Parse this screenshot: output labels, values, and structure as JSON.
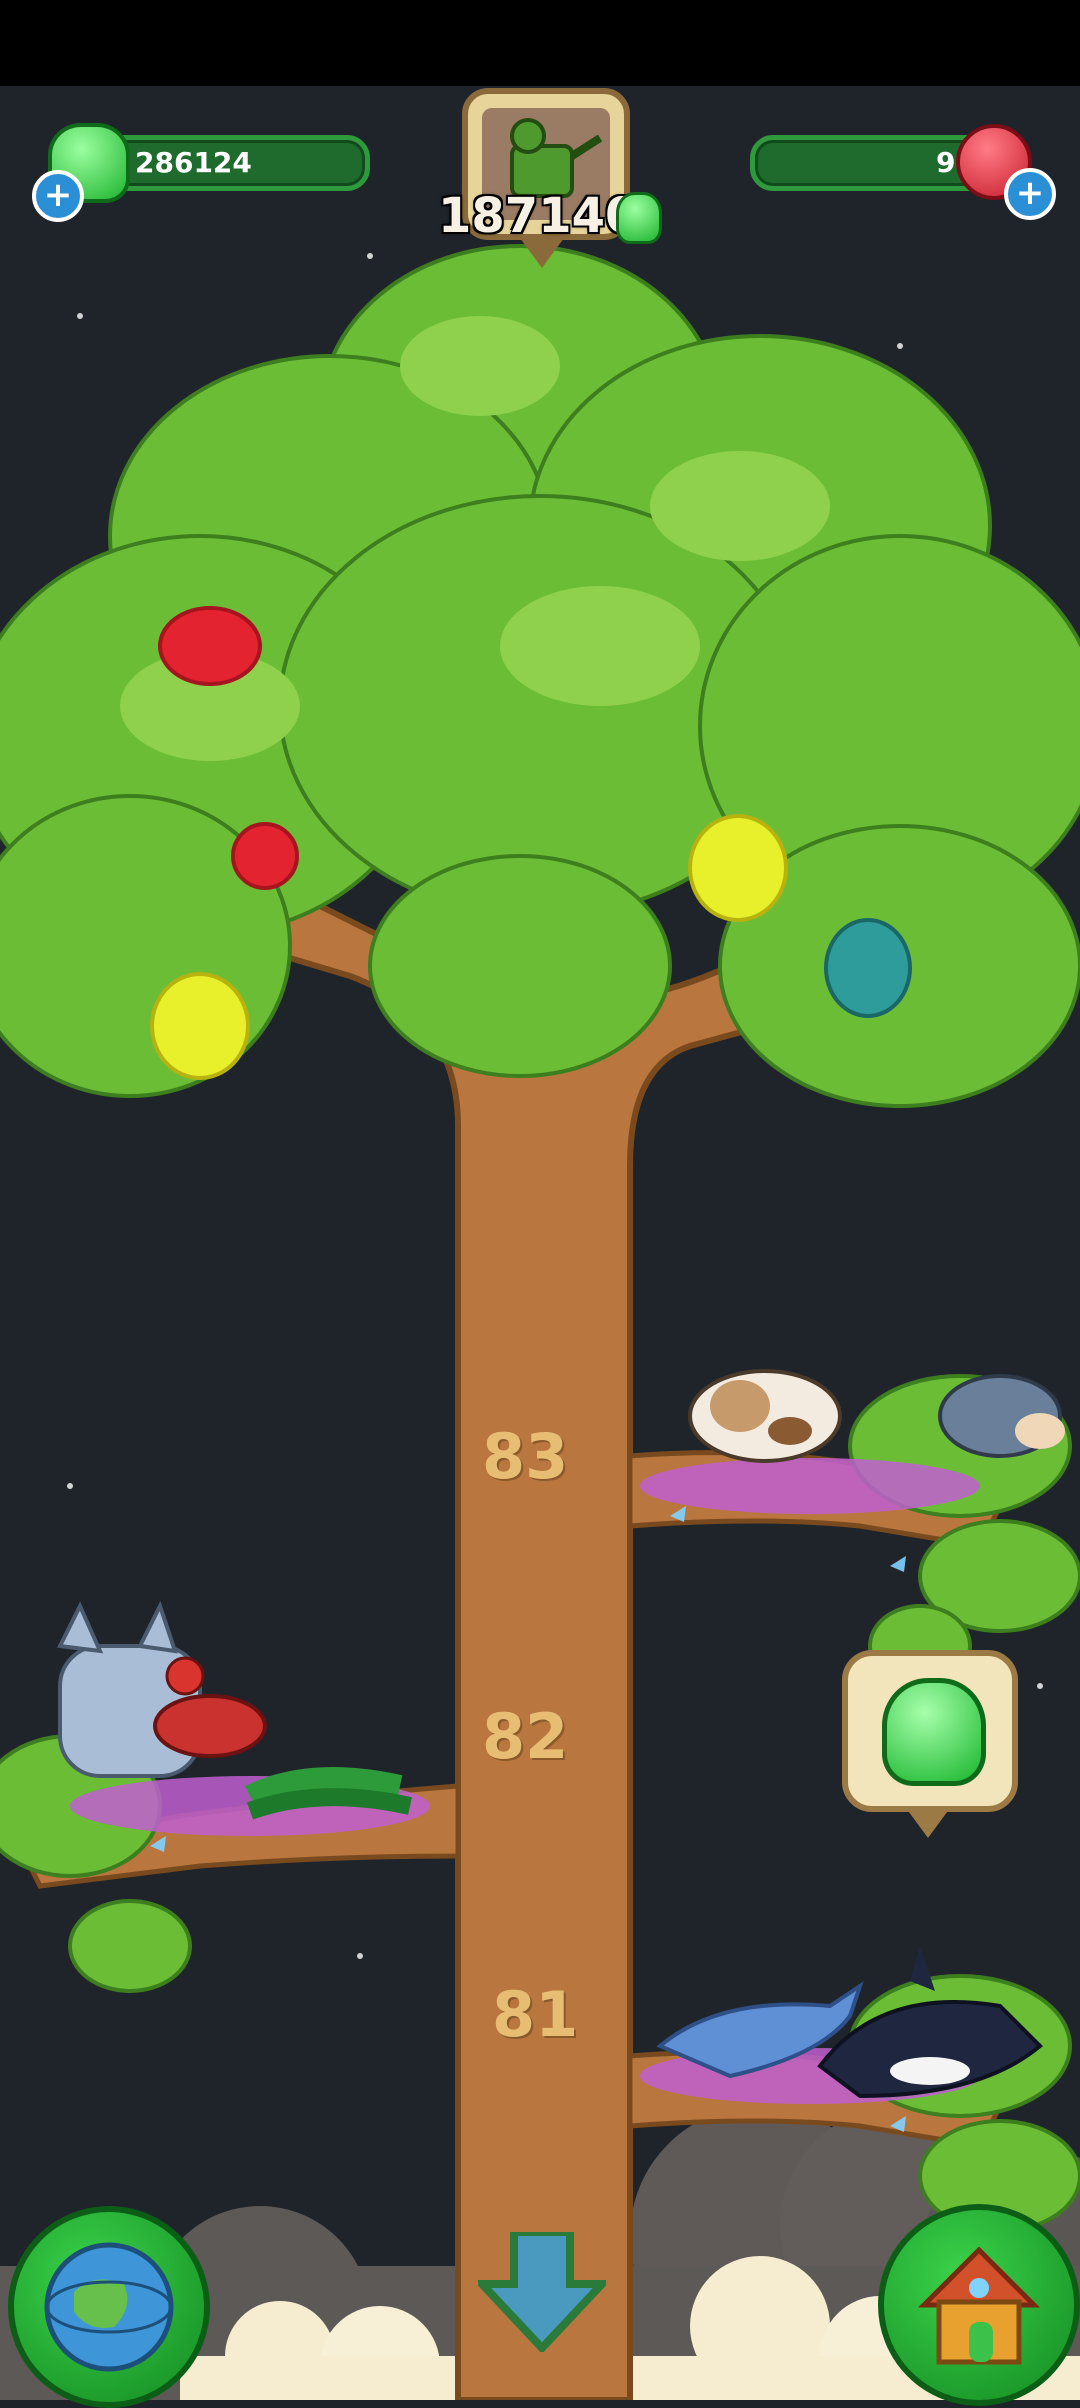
{
  "hud": {
    "gems_left": "286124",
    "center_value": "187140",
    "gems_right": "95"
  },
  "levels": {
    "level_83": "83",
    "level_82": "82",
    "level_81": "81"
  },
  "icons": {
    "left_resource": "green-gem-icon",
    "right_resource": "red-crystal-icon",
    "add": "plus-icon",
    "center_badge": "watering-can-icon",
    "world": "globe-icon",
    "home": "house-icon",
    "down": "down-arrow-icon",
    "reward_popup": "green-gem-popup-icon"
  },
  "colors": {
    "gem_green": "#2fd03f",
    "tree_leaf": "#6bbd35",
    "trunk": "#b9773f",
    "accent_blue": "#2b8fd6"
  }
}
